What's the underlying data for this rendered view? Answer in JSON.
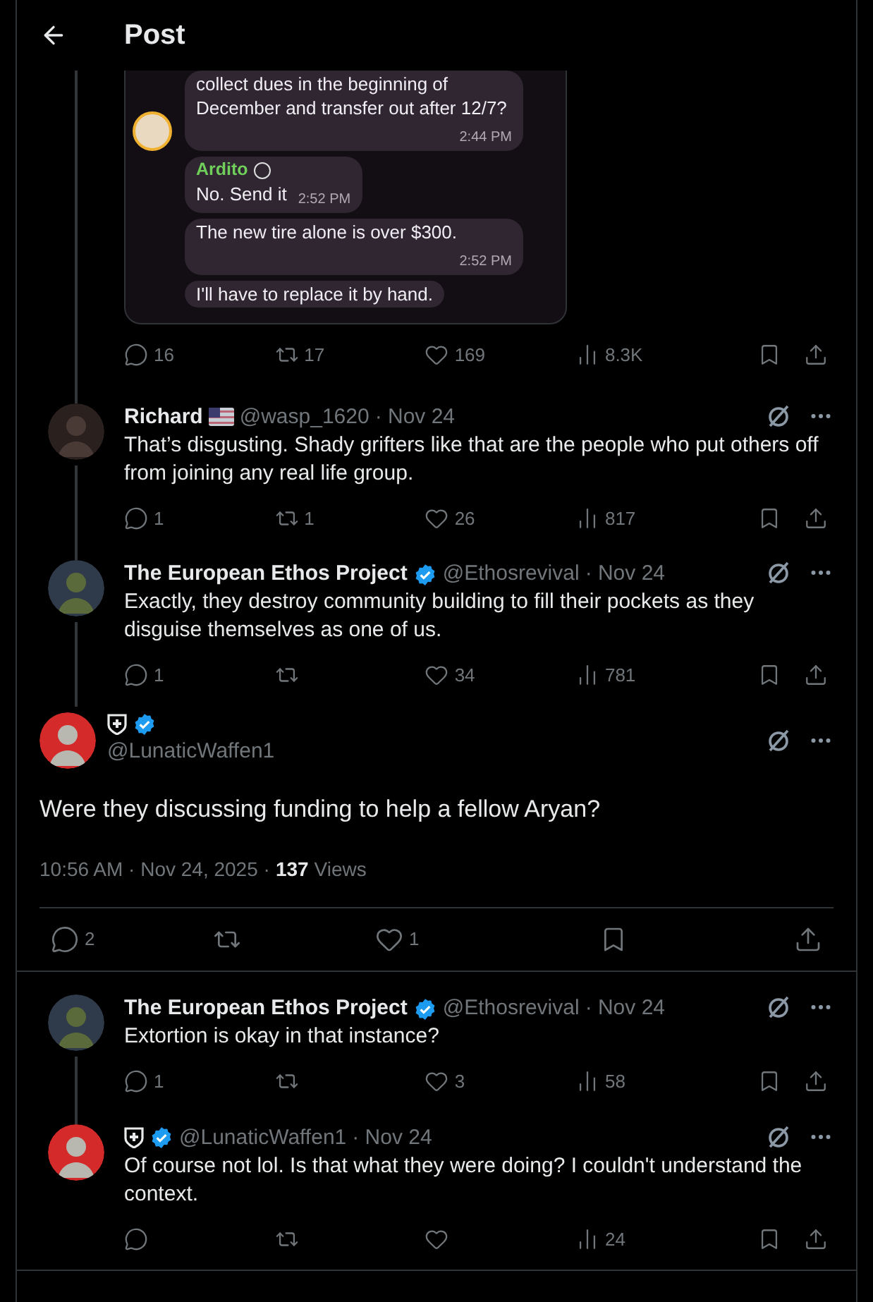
{
  "header": {
    "title": "Post"
  },
  "quoted_chat": {
    "messages": [
      {
        "avatar": true,
        "text": "collect dues in the beginning of December and transfer out after 12/7?",
        "time": "2:44 PM"
      },
      {
        "sender": "Ardito",
        "text": "No.  Send it",
        "time": "2:52 PM"
      },
      {
        "text": "The new tire alone is over $300.",
        "time": "2:52 PM"
      },
      {
        "text": "I'll have to replace it by hand."
      }
    ]
  },
  "top_post_stats": {
    "reply": "16",
    "repost": "17",
    "like": "169",
    "views": "8.3K"
  },
  "replies": [
    {
      "name": "Richard",
      "flag": true,
      "handle": "@wasp_1620",
      "date": "· Nov 24",
      "text": "That’s disgusting. Shady grifters like that are the people who put others off from joining any real life group.",
      "stats": {
        "reply": "1",
        "repost": "1",
        "like": "26",
        "views": "817"
      },
      "line_below": true
    },
    {
      "name": "The European Ethos Project",
      "verified": true,
      "handle": "@Ethosrevival",
      "date": "· Nov 24",
      "text": "Exactly, they destroy community building to fill their pockets as they disguise themselves as one of us.",
      "stats": {
        "reply": "1",
        "like": "34",
        "views": "781"
      },
      "line_below": true
    }
  ],
  "main_post": {
    "shield": true,
    "verified": true,
    "handle": "@LunaticWaffen1",
    "text": "Were they discussing funding to help a fellow Aryan?",
    "timestamp": "10:56 AM · Nov 24, 2025 ·",
    "views_count": "137",
    "views_label": "Views",
    "stats": {
      "reply": "2",
      "like": "1"
    }
  },
  "comments": [
    {
      "name": "The European Ethos Project",
      "verified": true,
      "handle": "@Ethosrevival",
      "date": "· Nov 24",
      "text": "Extortion is okay in that instance?",
      "stats": {
        "reply": "1",
        "like": "3",
        "views": "58"
      },
      "line_below": true
    },
    {
      "verified": true,
      "shield": true,
      "handle": "@LunaticWaffen1",
      "date": "· Nov 24",
      "text": "Of course not lol. Is that what they were doing? I couldn't understand the context.",
      "stats": {
        "views": "24"
      }
    }
  ]
}
